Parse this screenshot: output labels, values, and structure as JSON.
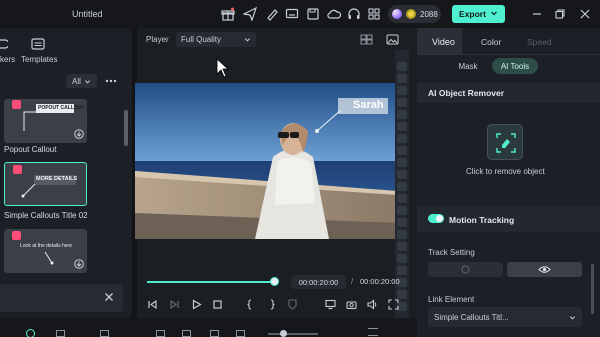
{
  "app": {
    "title": "Untitled",
    "credits": "2088",
    "export_label": "Export"
  },
  "left_panel": {
    "tabs": [
      "kers",
      "Templates"
    ],
    "filter": "All",
    "items": [
      {
        "label": "Popout Callout",
        "thumb_text": "POPOUT CALLOUT"
      },
      {
        "label": "Simple Callouts Title 02",
        "thumb_text": "MORE DETAILS"
      },
      {
        "label": "",
        "thumb_text": "Look at the details here"
      }
    ]
  },
  "player": {
    "label": "Player",
    "quality": "Full Quality",
    "callout_name": "Sarah",
    "current_time": "00:00:20:00",
    "separator": "/",
    "total_time": "00:00:20:00",
    "progress": 1.0
  },
  "right_panel": {
    "tabs": [
      "Video",
      "Color",
      "Speed"
    ],
    "active_tab": "Video",
    "subtabs": [
      "Mask",
      "AI Tools"
    ],
    "active_subtab": "AI Tools",
    "ai_object_remover_title": "AI Object Remover",
    "remove_hint": "Click to remove object",
    "motion_tracking_label": "Motion Tracking",
    "motion_tracking_on": true,
    "track_setting_label": "Track Setting",
    "link_element_label": "Link Element",
    "link_element_value": "Simple Callouts Titl..."
  },
  "colors": {
    "accent": "#4ef0cf",
    "panel": "#1c1f25",
    "background": "#121418"
  }
}
